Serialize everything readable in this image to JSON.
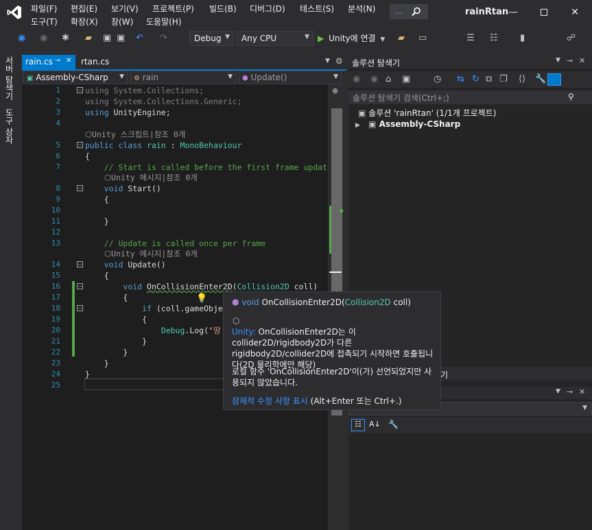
{
  "menus": [
    "파일(F)",
    "편집(E)",
    "보기(V)",
    "프로젝트(P)",
    "빌드(B)",
    "디버그(D)",
    "테스트(S)",
    "분석(N)",
    "도구(T)",
    "확장(X)",
    "창(W)",
    "도움말(H)"
  ],
  "search": {
    "placeholder": "..."
  },
  "window": {
    "solution_name": "rainRtan"
  },
  "toolbar": {
    "config": "Debug",
    "platform": "Any CPU",
    "run_label": "Unity에 연결"
  },
  "left_strip": {
    "server_explorer": "서버 탐색기",
    "toolbox": "도구 상자"
  },
  "tabs": {
    "active": "rain.cs",
    "inactive": "rtan.cs"
  },
  "navbar": {
    "project": "Assembly-CSharp",
    "class": "rain",
    "member": "Update()"
  },
  "editor": {
    "line_numbers": [
      "1",
      "2",
      "3",
      "4",
      "5",
      "6",
      "7",
      "8",
      "9",
      "10",
      "11",
      "12",
      "13",
      "14",
      "15",
      "16",
      "17",
      "18",
      "19",
      "20",
      "21",
      "22",
      "23",
      "24",
      "25"
    ],
    "codelens": {
      "script_refs": "Unity 스크립트|참조 0개",
      "message_refs_1": "Unity 메시지|참조 0개",
      "message_refs_2": "Unity 메시지|참조 0개"
    }
  },
  "solution_explorer": {
    "title": "솔루션 탐색기",
    "search_placeholder": "솔루션 탐색기 검색(Ctrl+;)",
    "solution_label": "솔루션 'rainRtan' (1/1개 프로젝트)",
    "project_label": "Assembly-CSharp"
  },
  "bottom_panel": {
    "partial_title": "기"
  },
  "tooltip": {
    "sig_keyword": "void",
    "sig_method": "OnCollisionEnter2D",
    "sig_type": "Collision2D",
    "sig_param": "coll",
    "unity_prefix": "Unity:",
    "desc": "OnCollisionEnter2D는 이 collider2D/rigidbody2D가 다른 rigidbody2D/collider2D에 접촉되기 시작하면 호출됩니다(2D 물리학에만 해당)",
    "note": "로컬 함수 'OnCollisionEnter2D'이(가) 선언되었지만 사용되지 않았습니다.",
    "fix_link": "잠재적 수정 사항 표시",
    "fix_shortcut": "(Alt+Enter 또는 Ctrl+.)"
  }
}
